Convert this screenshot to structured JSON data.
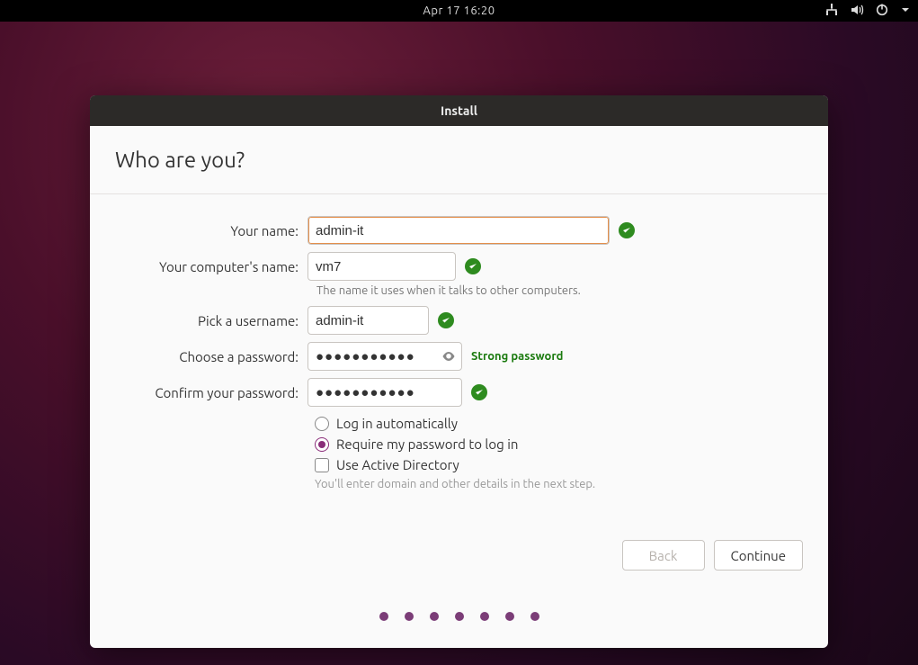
{
  "topbar": {
    "clock": "Apr 17  16:20"
  },
  "window": {
    "title": "Install"
  },
  "page": {
    "heading": "Who are you?",
    "name_label": "Your name:",
    "name_value": "admin-it",
    "computer_label": "Your computer's name:",
    "computer_value": "vm7",
    "computer_hint": "The name it uses when it talks to other computers.",
    "username_label": "Pick a username:",
    "username_value": "admin-it",
    "password_label": "Choose a password:",
    "password_value": "●●●●●●●●●●●",
    "password_strength": "Strong password",
    "confirm_label": "Confirm your password:",
    "confirm_value": "●●●●●●●●●●●",
    "opt_auto_login": "Log in automatically",
    "opt_req_password": "Require my password to log in",
    "opt_active_directory": "Use Active Directory",
    "ad_hint": "You'll enter domain and other details in the next step.",
    "selected_login_option": "require_password",
    "use_active_directory": false
  },
  "buttons": {
    "back": "Back",
    "continue": "Continue"
  },
  "progress": {
    "total_steps": 7,
    "current_step": 5
  }
}
